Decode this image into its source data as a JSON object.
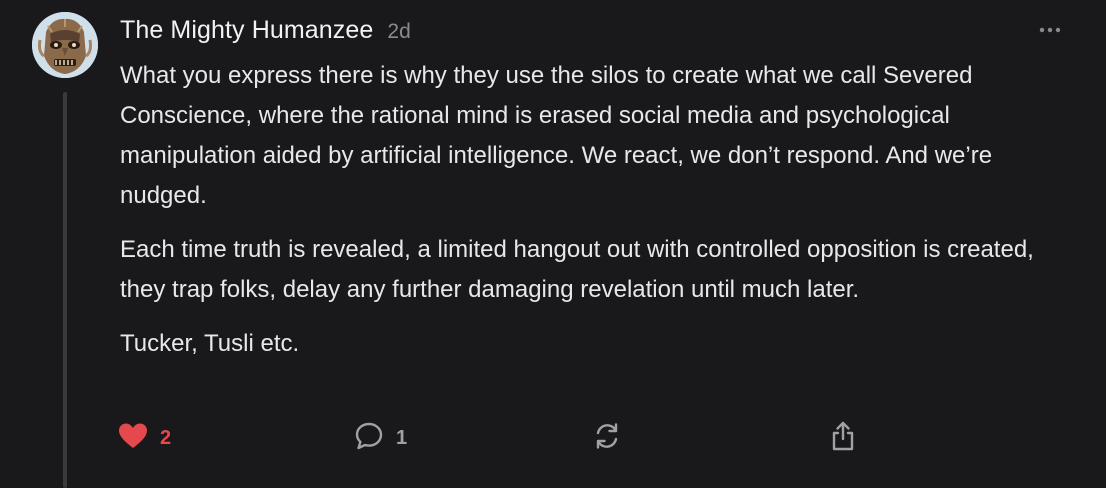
{
  "comment": {
    "author": "The Mighty Humanzee",
    "time": "2d",
    "paragraphs": [
      "What you express there is why they use the silos to create what we call Severed Conscience, where the rational mind is erased social media and psychological manipulation aided by artificial intelligence. We react, we don’t respond. And we’re nudged.",
      "Each time truth is revealed, a limited hangout out with controlled opposition is created, they trap folks, delay any further damaging revelation until much later.",
      "Tucker, Tusli etc."
    ],
    "likes": "2",
    "comments": "1"
  },
  "colors": {
    "background": "#19191b",
    "text": "#e8e8ea",
    "muted": "#8a8a8e",
    "like_red": "#e5484d",
    "icon_gray": "#a0a0a5",
    "thread_line": "#3a3a3c"
  },
  "icons": {
    "avatar": "avatar",
    "more": "more-options-icon",
    "like": "heart-icon",
    "comment": "comment-bubble-icon",
    "restack": "restack-icon",
    "share": "share-icon"
  }
}
